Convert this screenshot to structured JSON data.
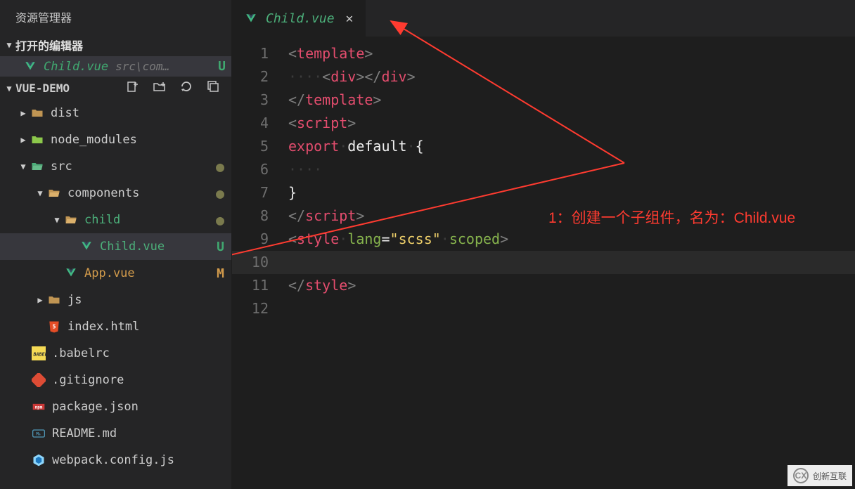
{
  "sidebar": {
    "title": "资源管理器",
    "openEditors": {
      "header": "打开的编辑器",
      "file": {
        "name": "Child.vue",
        "path": "src\\com…",
        "status": "U"
      }
    },
    "project": {
      "name": "VUE-DEMO"
    },
    "tree": {
      "dist": "dist",
      "node_modules": "node_modules",
      "src": "src",
      "components": "components",
      "child": "child",
      "child_vue": "Child.vue",
      "child_vue_status": "U",
      "app_vue": "App.vue",
      "app_vue_status": "M",
      "js": "js",
      "index_html": "index.html",
      "babelrc": ".babelrc",
      "gitignore": ".gitignore",
      "package_json": "package.json",
      "readme_md": "README.md",
      "webpack": "webpack.config.js"
    }
  },
  "tab": {
    "name": "Child.vue"
  },
  "code": {
    "l1": {
      "a": "<",
      "b": "template",
      "c": ">"
    },
    "l2": {
      "dots": "····",
      "a": "<",
      "b": "div",
      "c": "></",
      "d": "div",
      "e": ">"
    },
    "l3": {
      "a": "</",
      "b": "template",
      "c": ">"
    },
    "l4": {
      "a": "<",
      "b": "script",
      "c": ">"
    },
    "l5": {
      "a": "export",
      "sp": "·",
      "b": "default",
      "sp2": "·",
      "c": "{"
    },
    "l6": {
      "dots": "····"
    },
    "l7": {
      "a": "}"
    },
    "l8": {
      "a": "</",
      "b": "script",
      "c": ">"
    },
    "l9": {
      "a": "<",
      "b": "style",
      "sp": "·",
      "c": "lang",
      "d": "=",
      "e": "\"scss\"",
      "sp2": "·",
      "f": "scoped",
      "g": ">"
    },
    "l11": {
      "a": "</",
      "b": "style",
      "c": ">"
    }
  },
  "lines": {
    "1": "1",
    "2": "2",
    "3": "3",
    "4": "4",
    "5": "5",
    "6": "6",
    "7": "7",
    "8": "8",
    "9": "9",
    "10": "10",
    "11": "11",
    "12": "12"
  },
  "annotation": "1：创建一个子组件，名为：Child.vue",
  "watermark": "创新互联"
}
